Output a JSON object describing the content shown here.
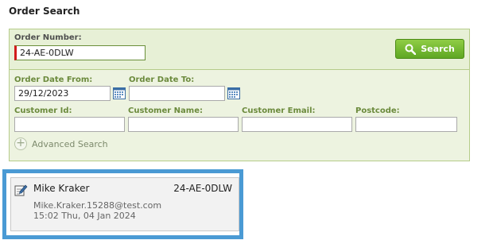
{
  "page": {
    "title": "Order Search"
  },
  "form": {
    "order_number_label": "Order Number:",
    "order_number_value": "24-AE-0DLW",
    "search_button_label": "Search",
    "date_from_label": "Order Date From:",
    "date_from_value": "29/12/2023",
    "date_to_label": "Order Date To:",
    "date_to_value": "",
    "customer_id_label": "Customer Id:",
    "customer_id_value": "",
    "customer_name_label": "Customer Name:",
    "customer_name_value": "",
    "customer_email_label": "Customer Email:",
    "customer_email_value": "",
    "postcode_label": "Postcode:",
    "postcode_value": "",
    "advanced_search_label": "Advanced Search"
  },
  "results": [
    {
      "customer_name": "Mike Kraker",
      "order_ref": "24-AE-0DLW",
      "email": "Mike.Kraker.15288@test.com",
      "datetime": "15:02 Thu, 04 Jan 2024"
    }
  ],
  "colors": {
    "accent_green": "#5fa723",
    "panel_bg": "#edf3e0",
    "required_marker": "#d21b1b",
    "selection_border": "#4a9ad4"
  },
  "icons": {
    "search_button": "magnifier-icon",
    "date_picker": "calendar-icon",
    "advanced_toggle": "plus-icon",
    "result_item": "edit-note-icon"
  }
}
